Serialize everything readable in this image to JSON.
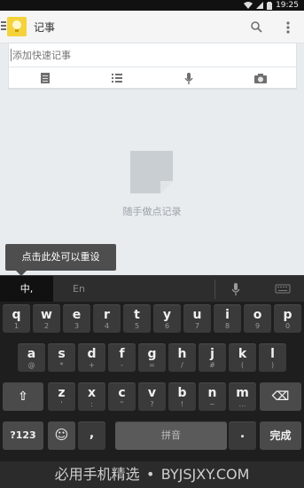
{
  "status_bar": {
    "time": "19:25"
  },
  "app_bar": {
    "title": "记事",
    "icons": [
      "menu-icon",
      "app-logo-icon",
      "search-icon",
      "overflow-menu-icon"
    ]
  },
  "composer": {
    "placeholder": "添加快速记事",
    "tools": [
      "note-icon",
      "list-icon",
      "mic-icon",
      "camera-icon"
    ]
  },
  "empty_state": {
    "text": "随手做点记录"
  },
  "tooltip": {
    "text": "点击此处可以重设"
  },
  "ime": {
    "top_bar": {
      "chinese_tab": "中,",
      "english_tab": "En"
    },
    "rows": [
      [
        {
          "main": "q",
          "sub": "1"
        },
        {
          "main": "w",
          "sub": "2"
        },
        {
          "main": "e",
          "sub": "3"
        },
        {
          "main": "r",
          "sub": "4"
        },
        {
          "main": "t",
          "sub": "5"
        },
        {
          "main": "y",
          "sub": "6"
        },
        {
          "main": "u",
          "sub": "7"
        },
        {
          "main": "i",
          "sub": "8"
        },
        {
          "main": "o",
          "sub": "9"
        },
        {
          "main": "p",
          "sub": "0"
        }
      ],
      [
        {
          "main": "a",
          "sub": "@"
        },
        {
          "main": "s",
          "sub": "*"
        },
        {
          "main": "d",
          "sub": "+"
        },
        {
          "main": "f",
          "sub": "-"
        },
        {
          "main": "g",
          "sub": "="
        },
        {
          "main": "h",
          "sub": "/"
        },
        {
          "main": "j",
          "sub": "#"
        },
        {
          "main": "k",
          "sub": "("
        },
        {
          "main": "l",
          "sub": ")"
        }
      ],
      [
        {
          "main": "z",
          "sub": "'"
        },
        {
          "main": "x",
          "sub": ":"
        },
        {
          "main": "c",
          "sub": "\""
        },
        {
          "main": "v",
          "sub": "?"
        },
        {
          "main": "b",
          "sub": "!"
        },
        {
          "main": "n",
          "sub": "~"
        },
        {
          "main": "m",
          "sub": "…"
        }
      ]
    ],
    "special": {
      "shift": "⇧",
      "backspace": "⌫",
      "num": "?123",
      "emoji": "☺",
      "comma": ",",
      "space": "拼音",
      "period": ".",
      "enter": "完成"
    }
  },
  "footer": {
    "left": "必用手机精选",
    "right": "BYJSJXY.COM"
  }
}
